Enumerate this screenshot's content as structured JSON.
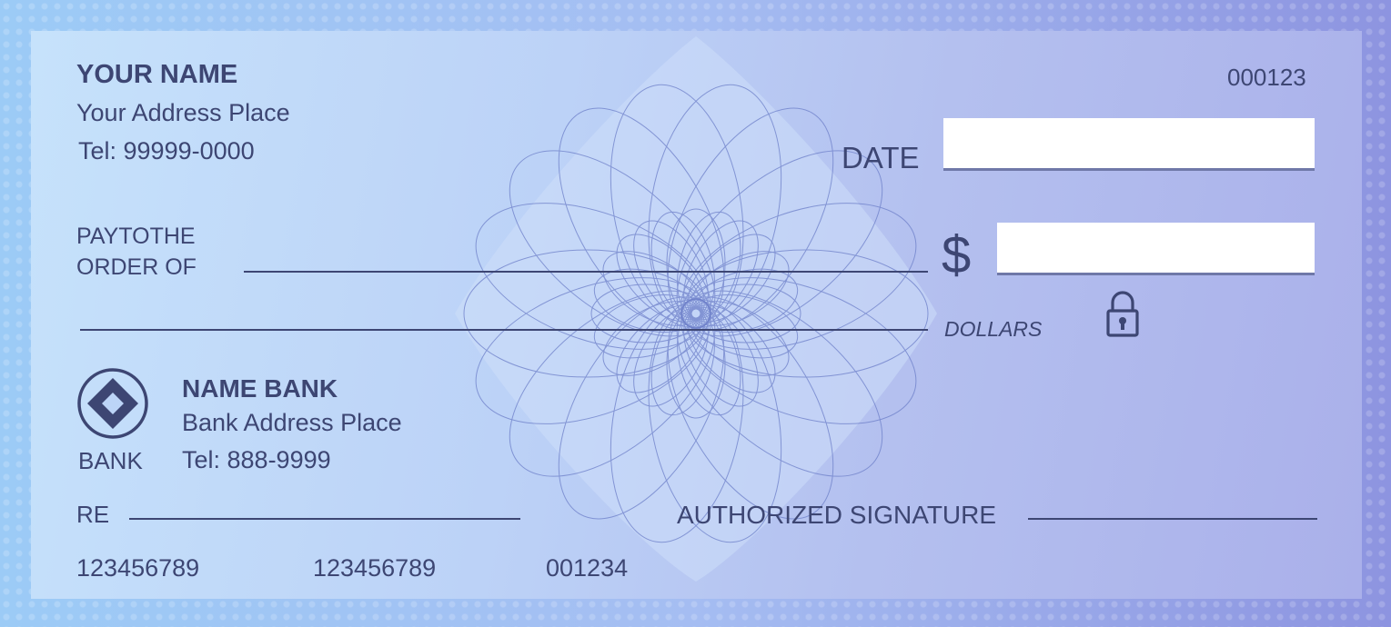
{
  "payer": {
    "name": "YOUR NAME",
    "address": "Your Address Place",
    "tel": "Tel: 99999-0000"
  },
  "check_number": "000123",
  "date_label": "DATE",
  "pay_to_line1": "PAYTOTHE",
  "pay_to_line2": "ORDER OF",
  "currency_symbol": "$",
  "dollars_label": "DOLLARS",
  "bank": {
    "logo_label": "BANK",
    "name": "NAME BANK",
    "address": "Bank Address Place",
    "tel": "Tel: 888-9999"
  },
  "memo_label": "RE",
  "signature_label": "AUTHORIZED SIGNATURE",
  "micr": {
    "routing": "123456789",
    "account": "123456789",
    "check": "001234"
  },
  "icons": [
    "lock-icon",
    "bank-logo-icon"
  ],
  "colors": {
    "text": "#3d4673",
    "accent": "#8d94e0"
  }
}
